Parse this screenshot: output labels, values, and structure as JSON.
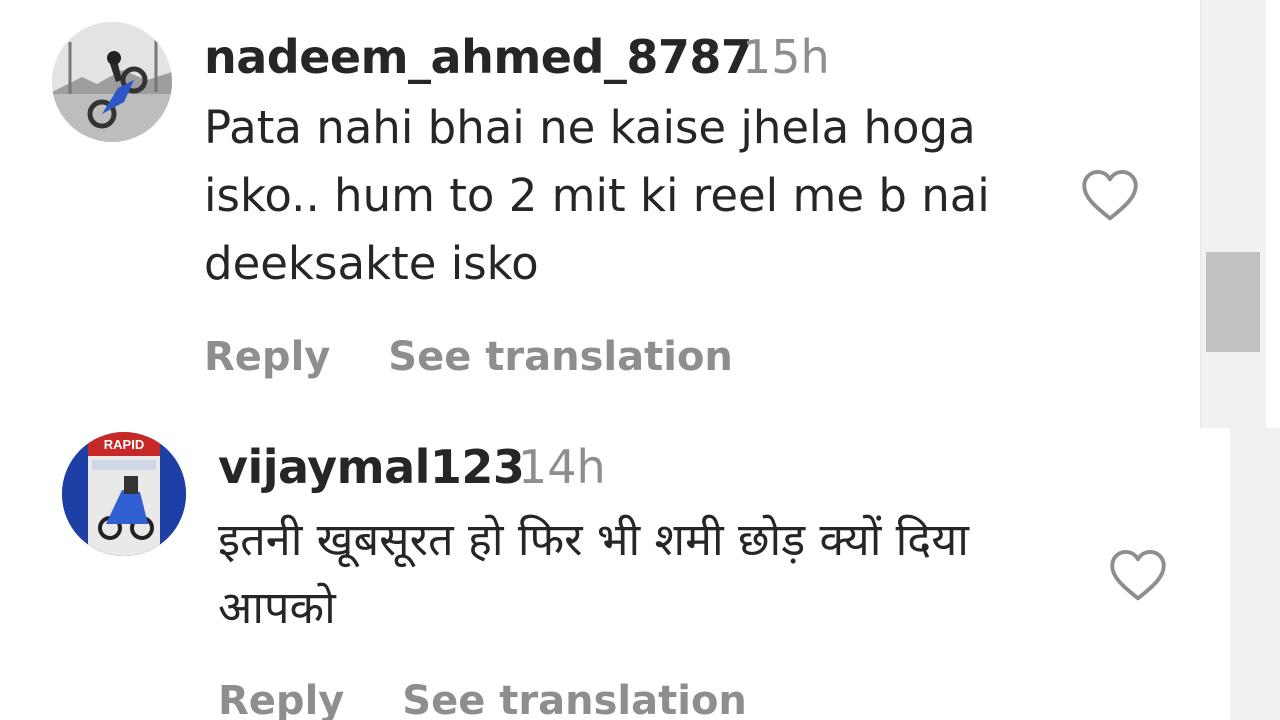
{
  "comments": [
    {
      "username": "nadeem_ahmed_8787",
      "time": "15h",
      "text": "Pata nahi bhai ne kaise jhela hoga isko.. hum to 2 mit ki reel me b nai deeksakte isko",
      "reply_label": "Reply",
      "translate_label": "See translation",
      "like_icon": "heart-outline-icon",
      "avatar": "motorbike-stunt-photo"
    },
    {
      "username": "vijaymal123",
      "time": "14h",
      "text": "इतनी खूबसूरत हो फिर भी शमी छोड़ क्यों दिया आपको",
      "reply_label": "Reply",
      "translate_label": "See translation",
      "like_icon": "heart-outline-icon",
      "avatar": "rapid-scooter-poster",
      "avatar_badge": "RAPID"
    }
  ],
  "colors": {
    "text_primary": "#262626",
    "text_secondary": "#8e8e8e",
    "scrollbar_track": "#f1f1f1",
    "scrollbar_thumb": "#c1c1c1"
  }
}
